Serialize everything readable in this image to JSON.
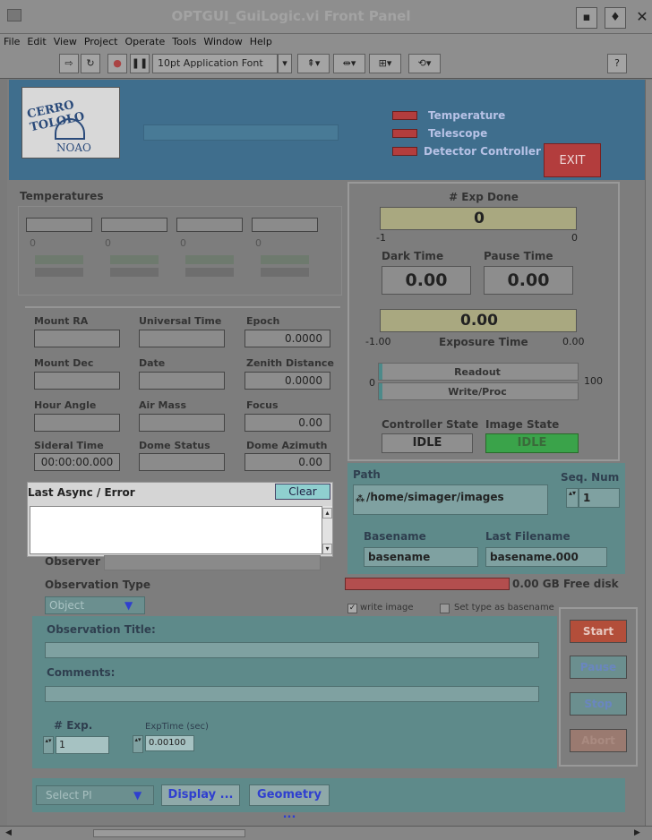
{
  "window": {
    "title": "OPTGUI_GuiLogic.vi Front Panel"
  },
  "menu": [
    "File",
    "Edit",
    "View",
    "Project",
    "Operate",
    "Tools",
    "Window",
    "Help"
  ],
  "toolbar": {
    "font": "10pt Application Font"
  },
  "header": {
    "logo_top": "CERRO TOLOLO",
    "logo_bottom": "NOAO",
    "status": [
      "Temperature",
      "Telescope",
      "Detector Controller"
    ],
    "exit": "EXIT"
  },
  "temps": {
    "title": "Temperatures",
    "values": [
      "0",
      "0",
      "0",
      "0"
    ]
  },
  "telescope": {
    "fields": [
      {
        "label": "Mount RA",
        "value": ""
      },
      {
        "label": "Universal Time",
        "value": ""
      },
      {
        "label": "Epoch",
        "value": "0.0000"
      },
      {
        "label": "Mount Dec",
        "value": ""
      },
      {
        "label": "Date",
        "value": ""
      },
      {
        "label": "Zenith Distance",
        "value": "0.0000"
      },
      {
        "label": "Hour Angle",
        "value": ""
      },
      {
        "label": "Air Mass",
        "value": ""
      },
      {
        "label": "Focus",
        "value": "0.00"
      },
      {
        "label": "Sideral Time",
        "value": "00:00:00.000"
      },
      {
        "label": "Dome Status",
        "value": ""
      },
      {
        "label": "Dome Azimuth",
        "value": "0.00"
      }
    ]
  },
  "exposure": {
    "exp_done_label": "# Exp Done",
    "exp_done_value": "0",
    "exp_done_min": "-1",
    "exp_done_max": "0",
    "dark_label": "Dark Time",
    "dark_value": "0.00",
    "pause_label": "Pause Time",
    "pause_value": "0.00",
    "exp_time_value": "0.00",
    "exp_time_label": "Exposure Time",
    "exp_min": "-1.00",
    "exp_max": "0.00",
    "prog_min": "0",
    "prog_max": "100",
    "readout": "Readout",
    "writeproc": "Write/Proc",
    "ctrl_state_label": "Controller State",
    "ctrl_state": "IDLE",
    "img_state_label": "Image State",
    "img_state": "IDLE"
  },
  "async": {
    "label": "Last Async / Error",
    "clear": "Clear"
  },
  "path": {
    "label": "Path",
    "value": "/home/simager/images",
    "seq_label": "Seq. Num",
    "seq_value": "1",
    "basename_label": "Basename",
    "basename": "basename",
    "lastfile_label": "Last Filename",
    "lastfile": "basename.000",
    "free_disk": "0.00 GB Free disk",
    "write_image": "write image",
    "set_type": "Set type as basename"
  },
  "observer": {
    "label": "Observer",
    "value": ""
  },
  "obstype": {
    "label": "Observation Type",
    "value": "Object"
  },
  "obs": {
    "title_label": "Observation Title:",
    "comments_label": "Comments:",
    "nexp_label": "# Exp.",
    "nexp_value": "1",
    "exptime_label": "ExpTime (sec)",
    "exptime_value": "0.00100"
  },
  "controls": {
    "start": "Start",
    "pause": "Pause",
    "stop": "Stop",
    "abort": "Abort"
  },
  "bottom": {
    "select_pi": "Select PI",
    "display": "Display ...",
    "geometry": "Geometry ..."
  },
  "colors": {
    "header": "#3f6e8d",
    "exit": "#b33d3d",
    "idle_green": "#3aa34a",
    "teal": "#5e8a8a"
  }
}
